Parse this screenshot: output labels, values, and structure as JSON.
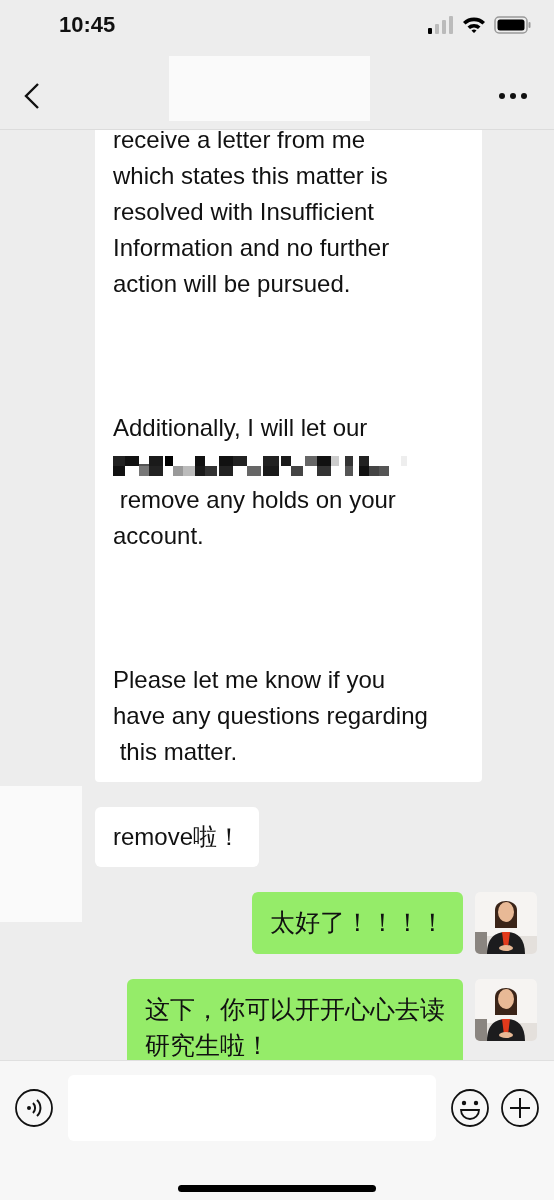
{
  "status_bar": {
    "time": "10:45"
  },
  "messages": [
    {
      "kind": "incoming",
      "lines": [
        {
          "kind": "text",
          "text": "receive a letter from me"
        },
        {
          "kind": "text",
          "text": "which states this matter is"
        },
        {
          "kind": "text",
          "text": "resolved with Insufficient"
        },
        {
          "kind": "text",
          "text": "Information and no further"
        },
        {
          "kind": "text",
          "text": "action will be pursued."
        },
        {
          "kind": "gap"
        },
        {
          "kind": "gap"
        },
        {
          "kind": "gap"
        },
        {
          "kind": "text",
          "text": "Additionally, I will let our"
        },
        {
          "kind": "redacted"
        },
        {
          "kind": "text",
          "text": " remove any holds on your"
        },
        {
          "kind": "text",
          "text": "account."
        },
        {
          "kind": "gap"
        },
        {
          "kind": "gap"
        },
        {
          "kind": "gap"
        },
        {
          "kind": "text",
          "text": "Please let me know if you"
        },
        {
          "kind": "text",
          "text": "have any questions regarding"
        },
        {
          "kind": "text",
          "text": " this matter."
        }
      ]
    },
    {
      "kind": "incoming",
      "avatar": {
        "kind": "blank"
      },
      "lines": [
        {
          "kind": "text",
          "text": "remove啦！"
        }
      ]
    },
    {
      "kind": "outgoing",
      "avatar": {
        "kind": "picture"
      },
      "lines": [
        {
          "kind": "text",
          "text": "太好了！！！！"
        }
      ]
    },
    {
      "kind": "outgoing",
      "avatar": {
        "kind": "picture"
      },
      "lines": [
        {
          "kind": "text",
          "text": "这下，你可以开开心心去读"
        },
        {
          "kind": "text",
          "text": "研究生啦！"
        }
      ]
    }
  ]
}
